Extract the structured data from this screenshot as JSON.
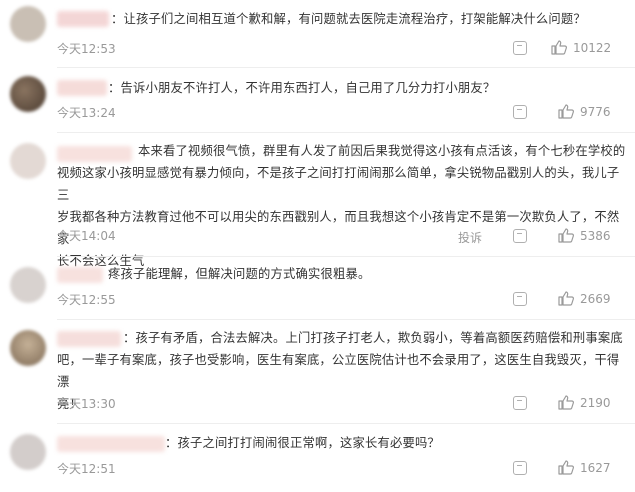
{
  "comments": [
    {
      "text": "：让孩子们之间相互道个歉和解，有问题就去医院走流程治疗，打架能解决什么问题？",
      "time": "今天12:53",
      "likes": "10122",
      "avatar_color": "#c9bfb4"
    },
    {
      "text": "：告诉小朋友不许打人，不许用东西打人，自己用了几分力打小朋友？",
      "time": "今天13:24",
      "likes": "9776",
      "avatar_color": "#6d5a4a"
    },
    {
      "text_lines": [
        "本来看了视频很气愤，群里有人发了前因后果我觉得这小孩有点活该，有个七秒在学校的",
        "视频这家小孩明显感觉有暴力倾向，不是孩子之间打打闹闹那么简单，拿尖锐物品戳别人的头，我儿子三",
        "岁我都各种方法教育过他不可以用尖的东西戳别人，而且我想这个小孩肯定不是第一次欺负人了，不然家",
        "长不会这么生气"
      ],
      "time": "今天14:04",
      "report_label": "投诉",
      "likes": "5386",
      "avatar_color": "#e0d6d0"
    },
    {
      "text": "疼孩子能理解，但解决问题的方式确实很粗暴。",
      "time": "今天12:55",
      "likes": "2669",
      "avatar_color": "#d8d2cf"
    },
    {
      "text_lines": [
        "：孩子有矛盾，合法去解决。上门打孩子打老人，欺负弱小，等着高额医药赔偿和刑事案底",
        "吧，一辈子有案底，孩子也受影响，医生有案底，公立医院估计也不会录用了，这医生自我毁灭，干得漂",
        "亮！"
      ],
      "time": "今天13:30",
      "likes": "2190",
      "avatar_color": "#a9967f"
    },
    {
      "text": "：孩子之间打打闹闹很正常啊，这家长有必要吗？",
      "time": "今天12:51",
      "likes": "1627",
      "avatar_color": "#d3cdcb"
    }
  ],
  "colors": {
    "username_blur": "#f4d9d6",
    "meta_text": "#999999",
    "body_text": "#333333"
  },
  "icons": {
    "like": "thumbs-up-icon",
    "comment": "comment-icon"
  }
}
